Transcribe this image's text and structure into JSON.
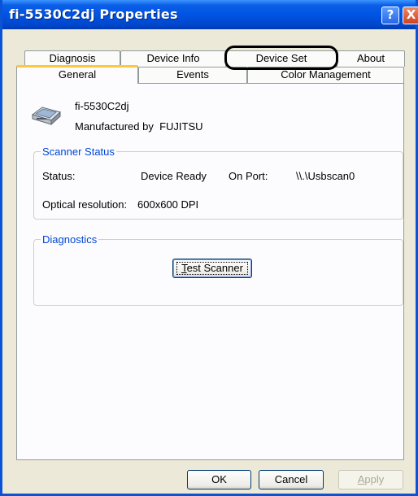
{
  "window": {
    "title": "fi-5530C2dj Properties",
    "help_glyph": "?",
    "close_glyph": "X"
  },
  "tabs": {
    "row1": [
      "Diagnosis",
      "Device Info",
      "Device Set",
      "About"
    ],
    "row2": [
      "General",
      "Events",
      "Color Management"
    ],
    "active": "General",
    "highlighted": "Device Set"
  },
  "device": {
    "icon": "scanner-icon",
    "name": "fi-5530C2dj",
    "manufacturer_label": "Manufactured by",
    "manufacturer": "FUJITSU"
  },
  "scanner_status": {
    "legend": "Scanner Status",
    "status_label": "Status:",
    "status_value": "Device Ready",
    "port_label": "On Port:",
    "port_value": "\\\\.\\Usbscan0",
    "resolution_label": "Optical resolution:",
    "resolution_value": "600x600 DPI"
  },
  "diagnostics": {
    "legend": "Diagnostics",
    "test_button": "Test Scanner",
    "test_button_mnemonic": "T",
    "test_button_rest": "est Scanner"
  },
  "footer": {
    "ok": "OK",
    "cancel": "Cancel",
    "apply": "Apply",
    "apply_mnemonic": "A",
    "apply_rest": "pply"
  },
  "colors": {
    "title_bar": "#0054e3",
    "dialog_face": "#ece9d8",
    "group_legend": "#0046d5",
    "active_tab_highlight": "#ffc83c"
  }
}
